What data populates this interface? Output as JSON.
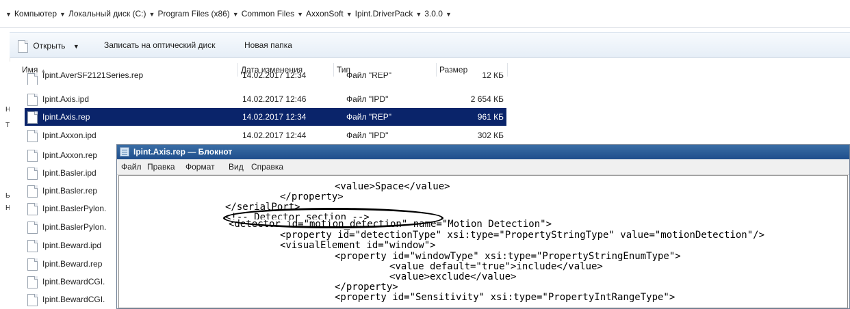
{
  "address": {
    "crumbs": [
      "Компьютер",
      "Локальный диск (C:)",
      "Program Files (x86)",
      "Common Files",
      "AxxonSoft",
      "Ipint.DriverPack",
      "3.0.0"
    ]
  },
  "toolbar": {
    "open_label": "Открыть",
    "burn_label": "Записать на оптический диск",
    "new_folder_label": "Новая папка"
  },
  "left_strip": [
    "Н",
    "Т",
    "Ь",
    "Н"
  ],
  "columns": {
    "name": "Имя",
    "date": "Дата изменения",
    "type": "Тип",
    "size": "Размер"
  },
  "files": [
    {
      "name": "Ipint.AverSF2121Series.rep",
      "date": "14.02.2017 12:34",
      "type": "Файл \"REP\"",
      "size": "12 КБ"
    },
    {
      "name": "Ipint.Axis.ipd",
      "date": "14.02.2017 12:46",
      "type": "Файл \"IPD\"",
      "size": "2 654 КБ"
    },
    {
      "name": "Ipint.Axis.rep",
      "date": "14.02.2017 12:34",
      "type": "Файл \"REP\"",
      "size": "961 КБ"
    },
    {
      "name": "Ipint.Axxon.ipd",
      "date": "14.02.2017 12:44",
      "type": "Файл \"IPD\"",
      "size": "302 КБ"
    },
    {
      "name": "Ipint.Axxon.rep"
    },
    {
      "name": "Ipint.Basler.ipd"
    },
    {
      "name": "Ipint.Basler.rep"
    },
    {
      "name": "Ipint.BaslerPylon."
    },
    {
      "name": "Ipint.BaslerPylon."
    },
    {
      "name": "Ipint.Beward.ipd"
    },
    {
      "name": "Ipint.Beward.rep"
    },
    {
      "name": "Ipint.BewardCGI."
    },
    {
      "name": "Ipint.BewardCGI."
    }
  ],
  "notepad": {
    "title": "Ipint.Axis.rep — Блокнот",
    "menu": [
      "Файл",
      "Правка",
      "Формат",
      "Вид",
      "Справка"
    ],
    "lines": [
      "<value>Space</value>",
      "</property>",
      "</serialPort>",
      "<!-- Detector section -->",
      "<detector id=\"motion_detection\" name=\"Motion Detection\">",
      "<property id=\"detectionType\" xsi:type=\"PropertyStringType\" value=\"motionDetection\"/>",
      "<visualElement id=\"window\">",
      "<property id=\"windowType\" xsi:type=\"PropertyStringEnumType\">",
      "<value default=\"true\">include</value>",
      "<value>exclude</value>",
      "</property>",
      "<property id=\"Sensitivity\" xsi:type=\"PropertyIntRangeType\">"
    ]
  },
  "colors": {
    "selection": "#0a246a",
    "notepad_title": "#1f4e8c",
    "toolbar": "#e6eef7"
  }
}
